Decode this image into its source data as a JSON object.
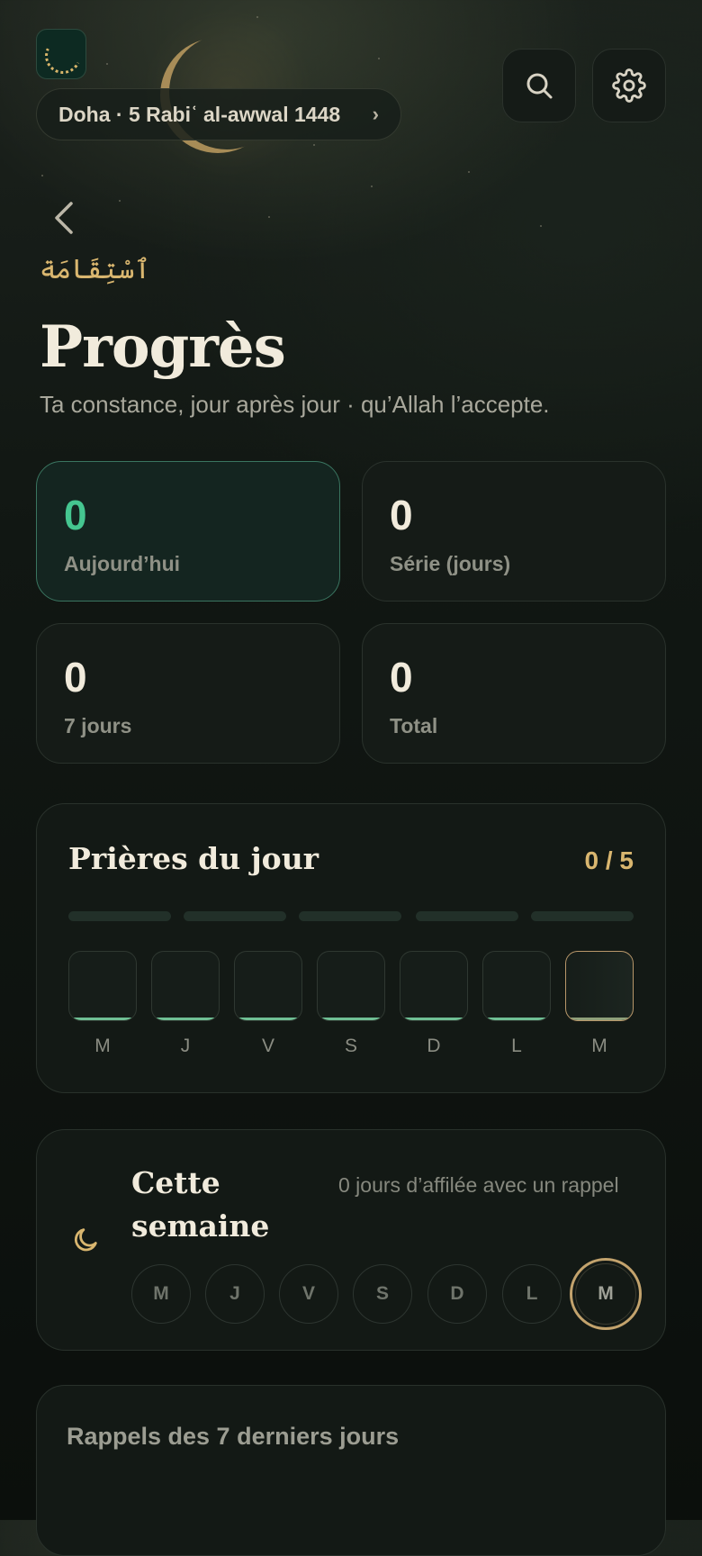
{
  "header": {
    "location_date": "Doha · 5 Rabiʿ al-awwal 1448",
    "search_icon": "search-icon",
    "settings_icon": "gear-icon"
  },
  "page": {
    "arabic_word": "ٱسْتِقَامَة",
    "title": "Progrès",
    "subtitle": "Ta constance, jour après jour · qu’Allah l’accepte."
  },
  "stats": [
    {
      "value": "0",
      "label": "Aujourd’hui"
    },
    {
      "value": "0",
      "label": "Série (jours)"
    },
    {
      "value": "0",
      "label": "7 jours"
    },
    {
      "value": "0",
      "label": "Total"
    }
  ],
  "prayers": {
    "title": "Prières du jour",
    "count": "0 / 5",
    "days": [
      "M",
      "J",
      "V",
      "S",
      "D",
      "L",
      "M"
    ]
  },
  "week": {
    "title": "Cette semaine",
    "subtitle": "0 jours d’affilée avec un rappel",
    "days": [
      "M",
      "J",
      "V",
      "S",
      "D",
      "L",
      "M"
    ]
  },
  "reminders": {
    "title": "Rappels des 7 derniers jours"
  },
  "colors": {
    "accent_green": "#45c690",
    "accent_gold": "#d9b66f"
  }
}
